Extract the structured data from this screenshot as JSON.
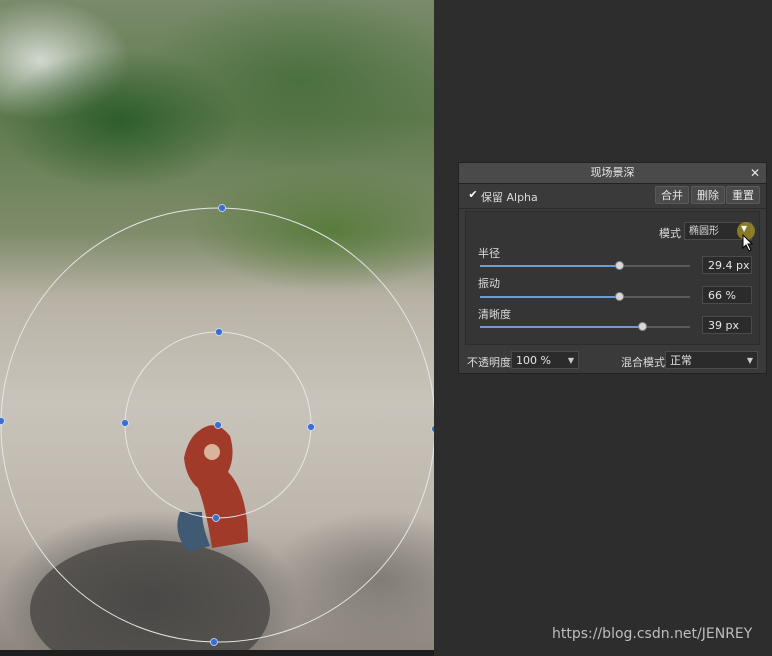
{
  "panel": {
    "title": "现场景深",
    "close_icon": "close-icon",
    "preserve_alpha": {
      "checked": true,
      "label": "保留 Alpha"
    },
    "buttons": {
      "merge": "合并",
      "delete": "删除",
      "reset": "重置"
    },
    "mode": {
      "label": "模式",
      "value": "椭圆形"
    },
    "sliders": [
      {
        "label": "半径",
        "value": "29.4 px",
        "level": 0.66
      },
      {
        "label": "振动",
        "value": "66 %",
        "level": 0.66
      },
      {
        "label": "清晰度",
        "value": "39 px",
        "level": 0.77
      }
    ],
    "opacity": {
      "label": "不透明度:",
      "value": "100 %"
    },
    "blend_mode": {
      "label": "混合模式:",
      "value": "正常"
    }
  },
  "watermark": "https://blog.csdn.net/JENREY",
  "colors": {
    "accent": "#6f9ad6",
    "handle": "#3a6fd0",
    "highlight": "#aa9628"
  }
}
